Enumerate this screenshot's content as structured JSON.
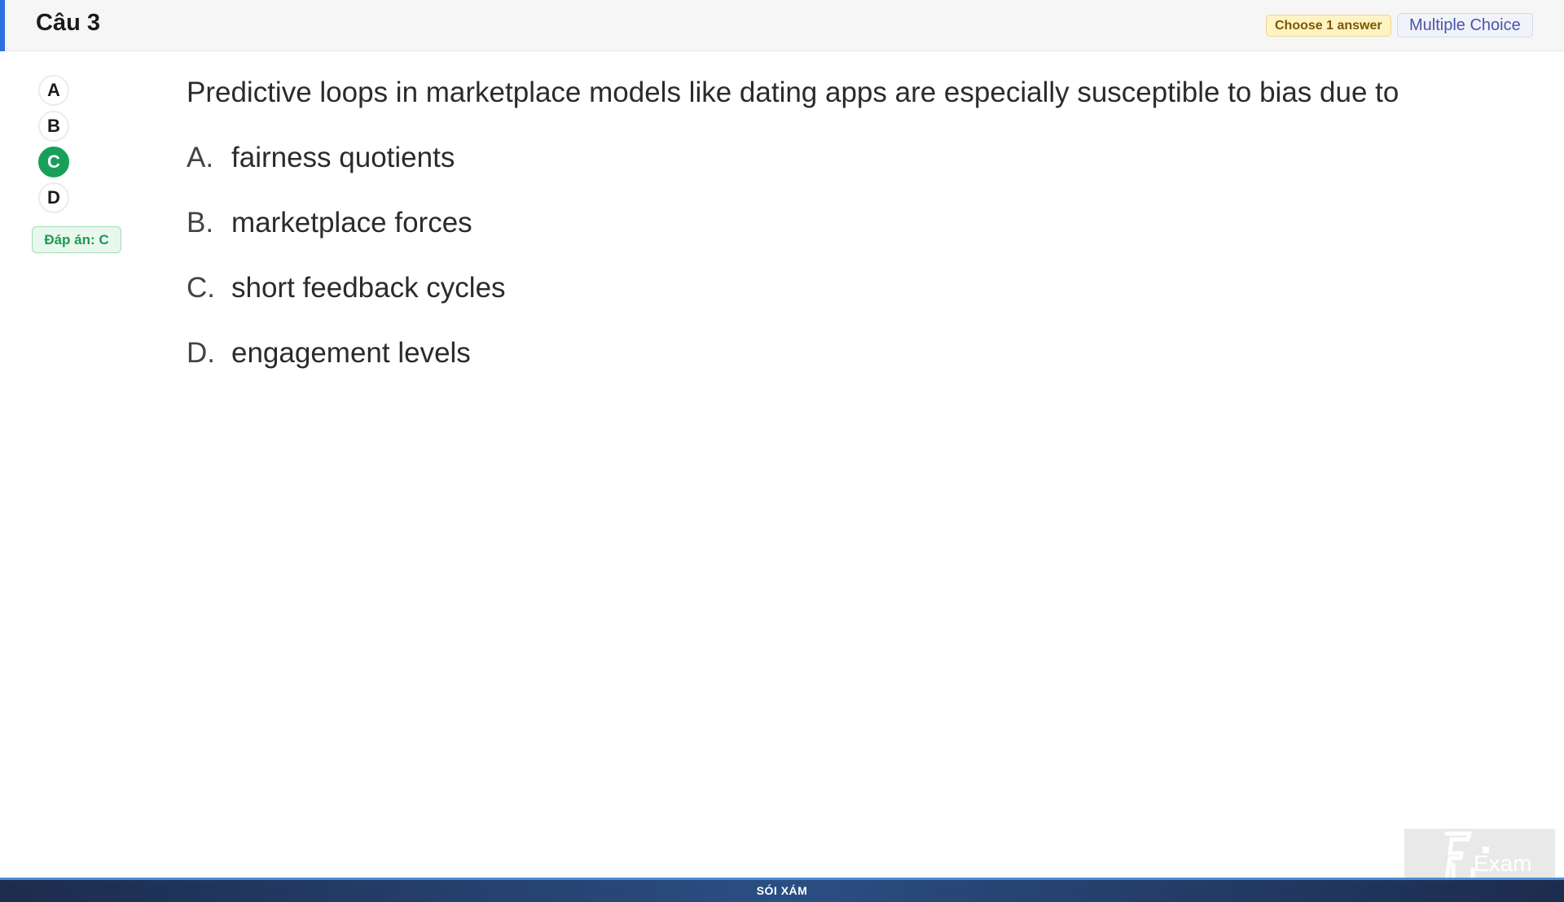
{
  "header": {
    "title": "Câu 3",
    "badge_choose": "Choose 1 answer",
    "badge_type": "Multiple Choice",
    "accent_color": "#2f6fe0"
  },
  "options_nav": {
    "items": [
      {
        "label": "A",
        "selected": false
      },
      {
        "label": "B",
        "selected": false
      },
      {
        "label": "C",
        "selected": true
      },
      {
        "label": "D",
        "selected": false
      }
    ],
    "selected_color": "#18a05a",
    "answer_text": "Đáp án: C"
  },
  "question": {
    "text": "Predictive loops in marketplace models like dating apps are especially susceptible to bias due to",
    "choices": [
      {
        "letter": "A.",
        "text": "fairness quotients"
      },
      {
        "letter": "B.",
        "text": "marketplace forces"
      },
      {
        "letter": "C.",
        "text": "short feedback cycles"
      },
      {
        "letter": "D.",
        "text": "engagement levels"
      }
    ]
  },
  "footer": {
    "text": "SÓI XÁM"
  },
  "watermark": {
    "logo_text": "Exam"
  }
}
